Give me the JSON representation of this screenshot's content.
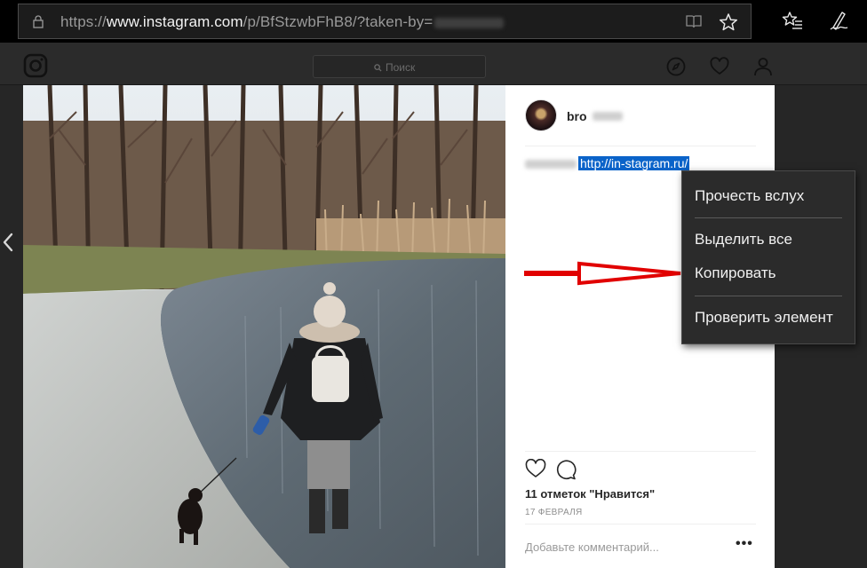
{
  "browser": {
    "url_scheme": "https://",
    "url_domain": "www.instagram.com",
    "url_path": "/p/BfStzwbFhB8/?taken-by="
  },
  "instagram": {
    "search_placeholder": "Поиск"
  },
  "post": {
    "username": "bro",
    "caption_link": "http://in-stagram.ru/",
    "likes": "11 отметок \"Нравится\"",
    "date": "17 ФЕВРАЛЯ",
    "comment_placeholder": "Добавьте комментарий...",
    "more": "•••"
  },
  "context_menu": {
    "items": [
      "Прочесть вслух",
      "Выделить все",
      "Копировать",
      "Проверить элемент"
    ]
  },
  "colors": {
    "highlight": "#0a63c9",
    "annotation_arrow": "#e10000"
  }
}
